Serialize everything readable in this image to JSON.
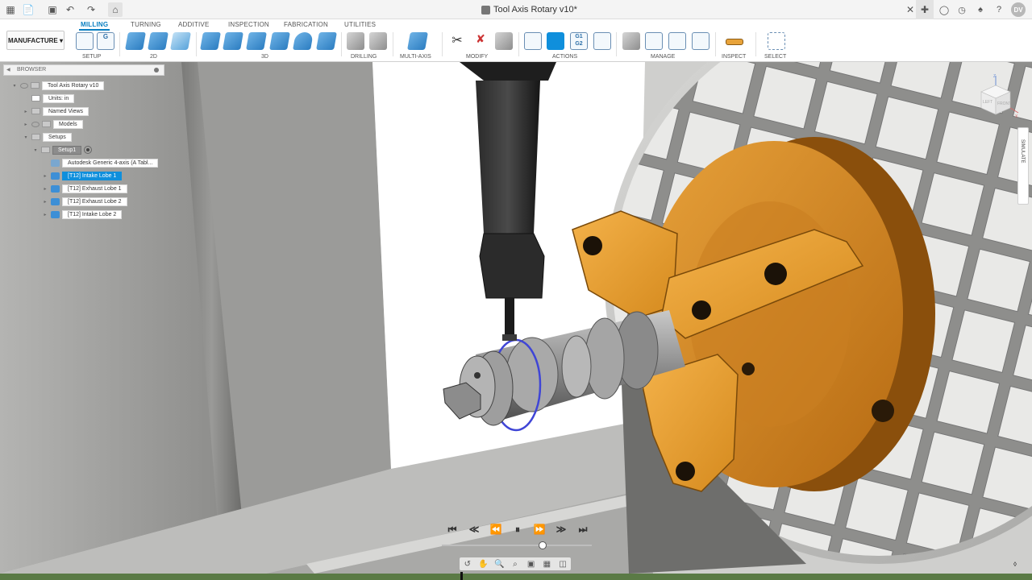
{
  "titlebar": {
    "document_title": "Tool Axis Rotary v10*",
    "user_initials": "DV"
  },
  "ribbon": {
    "workspace_label": "MANUFACTURE",
    "tabs": [
      "MILLING",
      "TURNING",
      "ADDITIVE",
      "INSPECTION",
      "FABRICATION",
      "UTILITIES"
    ],
    "active_tab": "MILLING",
    "groups": {
      "setup": "SETUP",
      "twod": "2D",
      "threed": "3D",
      "drilling": "DRILLING",
      "multiaxis": "MULTI-AXIS",
      "modify": "MODIFY",
      "actions": "ACTIONS",
      "manage": "MANAGE",
      "inspect": "INSPECT",
      "select": "SELECT"
    },
    "nc_icon_text": "G1\nG2",
    "setup_icon_text": "G"
  },
  "browser": {
    "header": "BROWSER",
    "nodes": {
      "root": "Tool Axis Rotary v10",
      "units": "Units: in",
      "named_views": "Named Views",
      "models": "Models",
      "setups": "Setups",
      "setup1": "Setup1",
      "machine": "Autodesk Generic 4-axis (A Tabl...",
      "op1": "[T12] Intake Lobe 1",
      "op2": "[T12] Exhaust Lobe 1",
      "op3": "[T12] Exhaust Lobe 2",
      "op4": "[T12] Intake Lobe 2"
    },
    "selected": "[T12] Intake Lobe 1"
  },
  "viewcube": {
    "left": "LEFT",
    "front": "FRONT",
    "axis_z": "Z",
    "axis_x": "X"
  },
  "side_tab": {
    "label": "SIMULATE"
  },
  "playback": {
    "progress_fraction": 0.67
  },
  "colors": {
    "accent": "#0a7fc1",
    "chuck_orange": "#e89a2c",
    "bottom_timeline": "#5a7a45"
  },
  "icons": [
    "grid-icon",
    "file-icon",
    "save-icon",
    "undo-icon",
    "redo-icon",
    "home-icon",
    "close-icon",
    "plus-icon",
    "help-icon",
    "bell-icon"
  ]
}
